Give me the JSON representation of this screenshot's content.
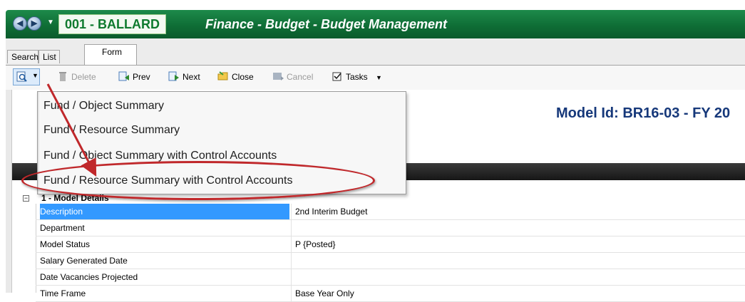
{
  "header": {
    "back_icon": "arrow-left-icon",
    "forward_icon": "arrow-right-icon",
    "org": "001 - BALLARD",
    "title": "Finance - Budget - Budget Management"
  },
  "tabs": [
    {
      "label": "Search"
    },
    {
      "label": "List"
    },
    {
      "label": "Form"
    }
  ],
  "toolbar": {
    "delete": "Delete",
    "prev": "Prev",
    "next": "Next",
    "close": "Close",
    "cancel": "Cancel",
    "tasks": "Tasks"
  },
  "menu": {
    "items": [
      {
        "label": "Fund / Object Summary"
      },
      {
        "label": "Fund / Resource Summary"
      },
      {
        "label": "Fund / Object Summary with Control Accounts"
      },
      {
        "label": "Fund / Resource Summary with Control Accounts"
      }
    ],
    "highlight_color": "#c0282b"
  },
  "form": {
    "model_id": "Model Id: BR16-03 - FY 20",
    "section_title": "1 - Model Details",
    "rows": [
      {
        "label": "Description",
        "value": "2nd Interim Budget",
        "selected": true
      },
      {
        "label": "Department",
        "value": ""
      },
      {
        "label": "Model Status",
        "value": "P {Posted}"
      },
      {
        "label": "Salary Generated Date",
        "value": ""
      },
      {
        "label": "Date Vacancies Projected",
        "value": ""
      },
      {
        "label": "Time Frame",
        "value": "Base Year Only"
      }
    ]
  },
  "colors": {
    "title_bar": "#0f6e36",
    "org_text": "#0e7a2e",
    "model_id": "#16387a",
    "selection": "#3399ff"
  }
}
